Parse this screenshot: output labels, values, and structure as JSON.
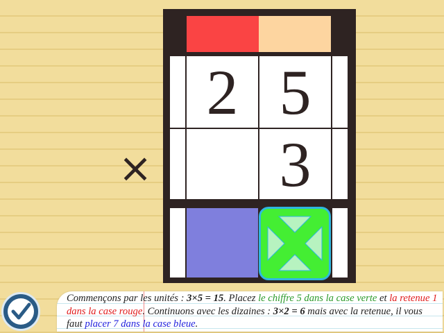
{
  "board": {
    "top_digits": [
      "2",
      "5"
    ],
    "bottom_digits": [
      "",
      "3"
    ],
    "operator": "×",
    "colors": {
      "frame": "#2e2322",
      "carry_red": "#fa4444",
      "carry_peach": "#fdd5a0",
      "answer_blue": "#7f7fdd",
      "answer_green": "#44ee33",
      "green_border": "#2fb7e0"
    }
  },
  "validate_button": {
    "icon": "checkmark-icon"
  },
  "instructions": {
    "part1": "Commençons par les unités : ",
    "calc1": "3×5 = 15",
    "part2": ". Placez ",
    "green_text": "le chiffre 5 dans la case verte",
    "part3": " et ",
    "red_text": "la retenue 1 dans la case rouge",
    "part4": ". Continuons avec les dizaines : ",
    "calc2": "3×2 = 6",
    "part5": " mais avec la retenue, il vous faut ",
    "blue_text": "placer 7 dans la case bleue",
    "part6": "."
  }
}
